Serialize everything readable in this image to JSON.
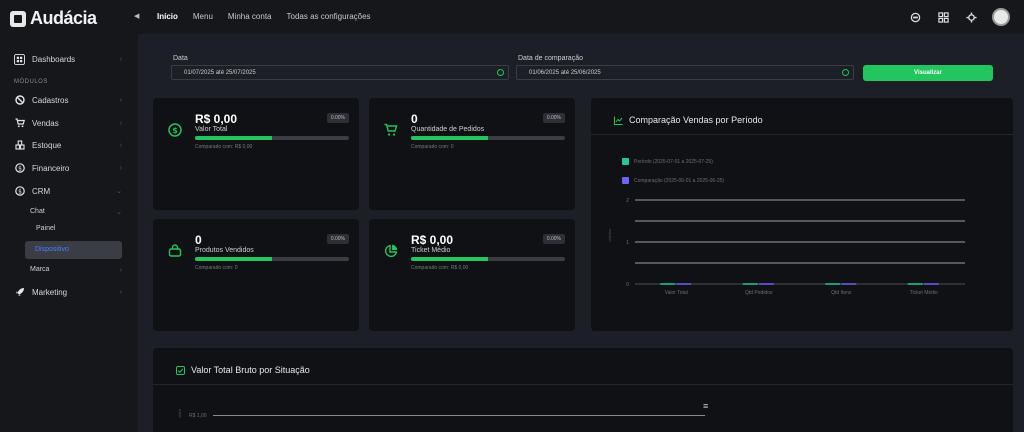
{
  "brand": {
    "name": "Audácia"
  },
  "topnav": [
    "Início",
    "Menu",
    "Minha conta",
    "Todas as configurações"
  ],
  "topicons": [
    "messages-icon",
    "apps-grid-icon",
    "settings-icon"
  ],
  "sidebar": {
    "dashboards": "Dashboards",
    "section": "MÓDULOS",
    "items": [
      "Cadastros",
      "Vendas",
      "Estoque",
      "Financeiro",
      "CRM"
    ],
    "chat": "Chat",
    "painel": "Painel",
    "active": "Dispositivo",
    "marca": "Marca",
    "marketing": "Marketing"
  },
  "filters": {
    "date_label": "Data",
    "date_value": "01/07/2025 até 25/07/2025",
    "compare_label": "Data de comparação",
    "compare_value": "01/06/2025 até 25/06/2025",
    "button": "Visualizar"
  },
  "cards": [
    {
      "value": "R$ 0,00",
      "label": "Valor Total",
      "pct": "0.00%",
      "compare": "Comparado com: R$ 0,00",
      "progress": 0.5
    },
    {
      "value": "0",
      "label": "Quantidade de Pedidos",
      "pct": "0.00%",
      "compare": "Comparado com: 0",
      "progress": 0.5
    },
    {
      "value": "0",
      "label": "Produtos Vendidos",
      "pct": "0.00%",
      "compare": "Comparado com: 0",
      "progress": 0.5
    },
    {
      "value": "R$ 0,00",
      "label": "Ticket Médio",
      "pct": "0.00%",
      "compare": "Comparado com: R$ 0,00",
      "progress": 0.5
    }
  ],
  "comparison": {
    "title": "Comparação Vendas por Período",
    "ylabel": "Valores"
  },
  "colors": {
    "accent": "#22c55e",
    "period": "#20c997",
    "compare": "#6f63f6"
  },
  "chart_data": [
    {
      "type": "bar",
      "title": "Comparação Vendas por Período",
      "categories": [
        "Valor Total",
        "Qtd Pedidos",
        "Qtd Itens",
        "Ticket Médio"
      ],
      "series": [
        {
          "name": "Período (2025-07-01 a 2025-07-25)",
          "values": [
            0,
            0,
            0,
            0
          ]
        },
        {
          "name": "Comparação (2025-06-01 a 2025-06-25)",
          "values": [
            0,
            0,
            0,
            0
          ]
        }
      ],
      "yticks": [
        "2",
        "1",
        "0"
      ],
      "ylim": [
        0,
        2
      ],
      "grid": true,
      "legend": "top-left"
    },
    {
      "type": "line",
      "title": "Valor Total Bruto por Situação",
      "ylabel": "Valor",
      "yticks": [
        "R$ 1,00"
      ],
      "series": []
    }
  ],
  "bruto": {
    "title": "Valor Total Bruto por Situação"
  }
}
